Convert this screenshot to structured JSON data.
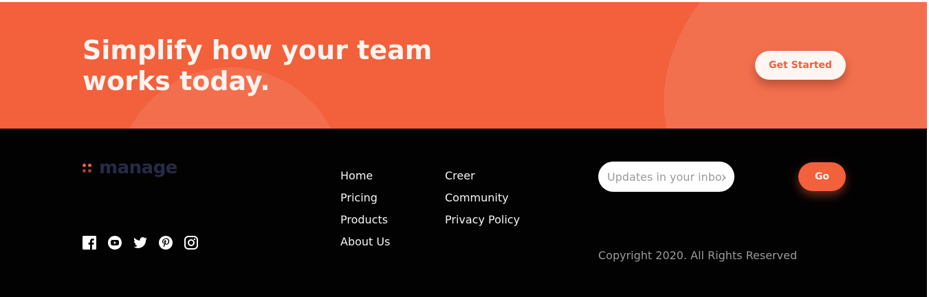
{
  "cta": {
    "headline_line1": "Simplify how your team",
    "headline_line2": "works today.",
    "button_label": "Get Started",
    "bg_color": "#f2603c"
  },
  "footer": {
    "logo_text": "manage",
    "socials": [
      {
        "icon": "facebook-icon"
      },
      {
        "icon": "youtube-icon"
      },
      {
        "icon": "twitter-icon"
      },
      {
        "icon": "pinterest-icon"
      },
      {
        "icon": "instagram-icon"
      }
    ],
    "nav_col1": [
      "Home",
      "Pricing",
      "Products",
      "About Us"
    ],
    "nav_col2": [
      "Creer",
      "Community",
      "Privacy Policy"
    ],
    "newsletter": {
      "placeholder": "Updates in your inbox.",
      "value": ""
    },
    "go_label": "Go",
    "copyright": "Copyright 2020. All Rights Reserved"
  }
}
